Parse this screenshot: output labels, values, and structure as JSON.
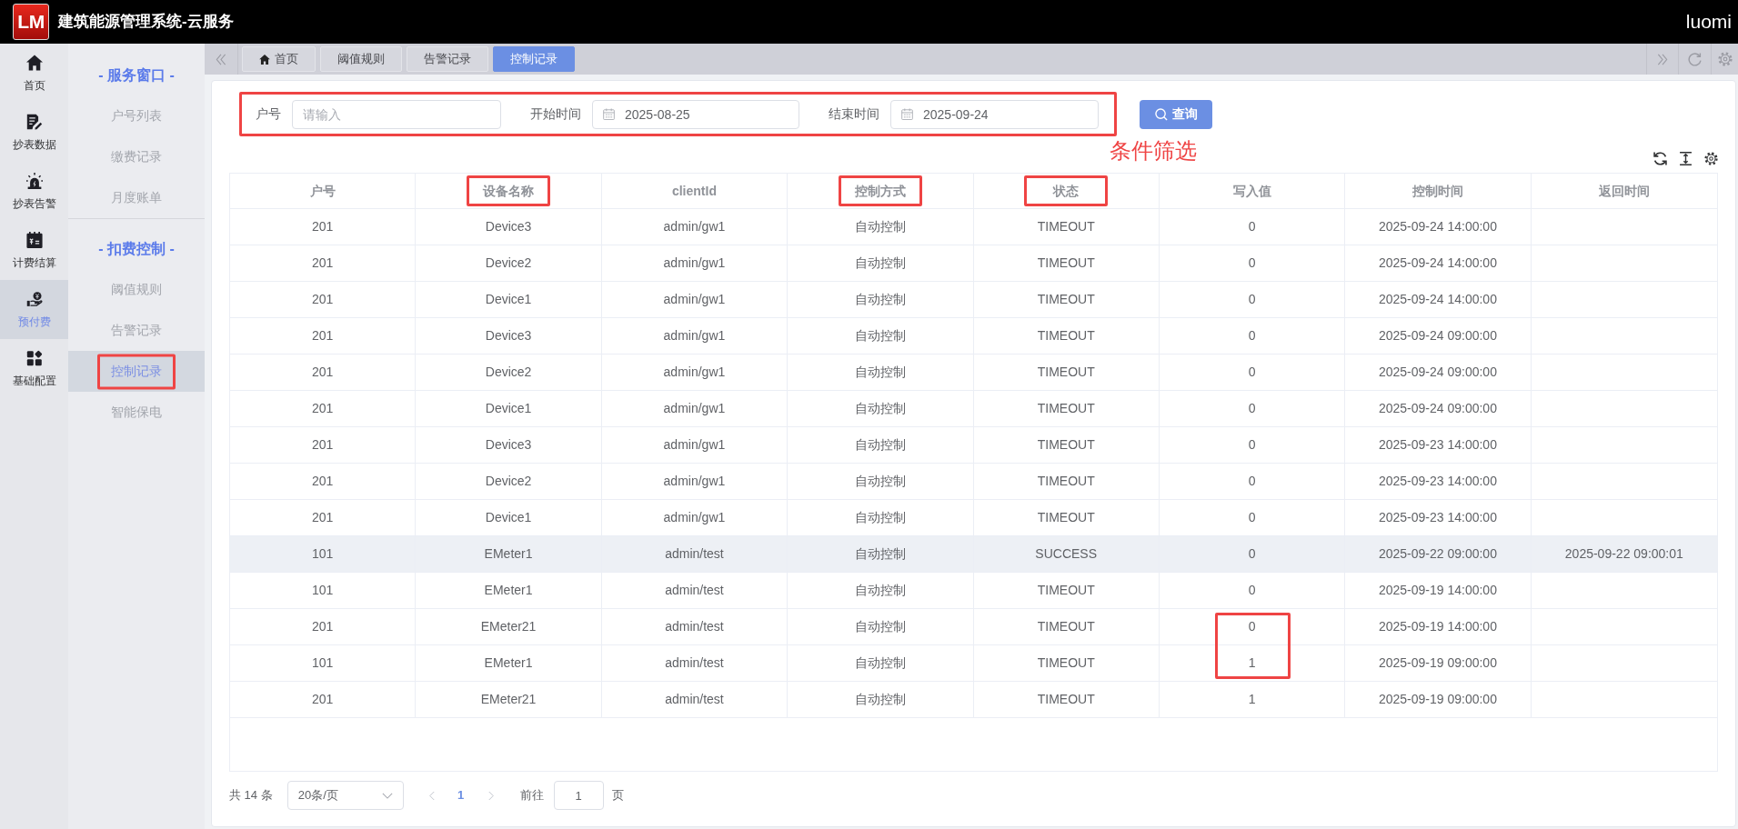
{
  "header": {
    "logo": "LM",
    "title": "建筑能源管理系统-云服务",
    "user": "luomi"
  },
  "nav_rail": [
    {
      "label": "首页",
      "selected": false
    },
    {
      "label": "抄表数据",
      "selected": false
    },
    {
      "label": "抄表告警",
      "selected": false
    },
    {
      "label": "计费结算",
      "selected": false
    },
    {
      "label": "预付费",
      "selected": true
    },
    {
      "label": "基础配置",
      "selected": false
    }
  ],
  "submenu": [
    {
      "title": "- 服务窗口 -",
      "items": [
        {
          "label": "户号列表",
          "selected": false,
          "highlighted": false
        },
        {
          "label": "缴费记录",
          "selected": false,
          "highlighted": false
        },
        {
          "label": "月度账单",
          "selected": false,
          "highlighted": false
        }
      ]
    },
    {
      "title": "- 扣费控制 -",
      "items": [
        {
          "label": "阈值规则",
          "selected": false,
          "highlighted": false
        },
        {
          "label": "告警记录",
          "selected": false,
          "highlighted": false
        },
        {
          "label": "控制记录",
          "selected": true,
          "highlighted": true
        },
        {
          "label": "智能保电",
          "selected": false,
          "highlighted": false
        }
      ]
    }
  ],
  "tabs": [
    {
      "kind": "home",
      "label": "首页",
      "selected": false
    },
    {
      "kind": "page",
      "label": "阈值规则",
      "selected": false
    },
    {
      "kind": "page",
      "label": "告警记录",
      "selected": false
    },
    {
      "kind": "page",
      "label": "控制记录",
      "selected": true
    }
  ],
  "filter": {
    "highlighted": true,
    "annotation": "条件筛选",
    "fields": [
      {
        "kind": "text",
        "label": "户号",
        "placeholder": "请输入"
      },
      {
        "kind": "date",
        "label": "开始时间",
        "value": "2025-08-25"
      },
      {
        "kind": "date",
        "label": "结束时间",
        "value": "2025-09-24"
      }
    ],
    "search_button": "查询"
  },
  "table": {
    "columns": [
      {
        "label": "户号",
        "highlighted": false
      },
      {
        "label": "设备名称",
        "highlighted": true
      },
      {
        "label": "clientId",
        "highlighted": false
      },
      {
        "label": "控制方式",
        "highlighted": true
      },
      {
        "label": "状态",
        "highlighted": true
      },
      {
        "label": "写入值",
        "highlighted": false
      },
      {
        "label": "控制时间",
        "highlighted": false
      },
      {
        "label": "返回时间",
        "highlighted": false
      }
    ],
    "rows": [
      {
        "account": "201",
        "device": "Device3",
        "client_id": "admin/gw1",
        "mode": "自动控制",
        "status": "TIMEOUT",
        "write_value": "0",
        "control_time": "2025-09-24 14:00:00",
        "hovered": false,
        "write_value_highlighted": false
      },
      {
        "account": "201",
        "device": "Device2",
        "client_id": "admin/gw1",
        "mode": "自动控制",
        "status": "TIMEOUT",
        "write_value": "0",
        "control_time": "2025-09-24 14:00:00",
        "hovered": false,
        "write_value_highlighted": false
      },
      {
        "account": "201",
        "device": "Device1",
        "client_id": "admin/gw1",
        "mode": "自动控制",
        "status": "TIMEOUT",
        "write_value": "0",
        "control_time": "2025-09-24 14:00:00",
        "hovered": false,
        "write_value_highlighted": false
      },
      {
        "account": "201",
        "device": "Device3",
        "client_id": "admin/gw1",
        "mode": "自动控制",
        "status": "TIMEOUT",
        "write_value": "0",
        "control_time": "2025-09-24 09:00:00",
        "hovered": false,
        "write_value_highlighted": false
      },
      {
        "account": "201",
        "device": "Device2",
        "client_id": "admin/gw1",
        "mode": "自动控制",
        "status": "TIMEOUT",
        "write_value": "0",
        "control_time": "2025-09-24 09:00:00",
        "hovered": false,
        "write_value_highlighted": false
      },
      {
        "account": "201",
        "device": "Device1",
        "client_id": "admin/gw1",
        "mode": "自动控制",
        "status": "TIMEOUT",
        "write_value": "0",
        "control_time": "2025-09-24 09:00:00",
        "hovered": false,
        "write_value_highlighted": false
      },
      {
        "account": "201",
        "device": "Device3",
        "client_id": "admin/gw1",
        "mode": "自动控制",
        "status": "TIMEOUT",
        "write_value": "0",
        "control_time": "2025-09-23 14:00:00",
        "hovered": false,
        "write_value_highlighted": false
      },
      {
        "account": "201",
        "device": "Device2",
        "client_id": "admin/gw1",
        "mode": "自动控制",
        "status": "TIMEOUT",
        "write_value": "0",
        "control_time": "2025-09-23 14:00:00",
        "hovered": false,
        "write_value_highlighted": false
      },
      {
        "account": "201",
        "device": "Device1",
        "client_id": "admin/gw1",
        "mode": "自动控制",
        "status": "TIMEOUT",
        "write_value": "0",
        "control_time": "2025-09-23 14:00:00",
        "hovered": false,
        "write_value_highlighted": false
      },
      {
        "account": "101",
        "device": "EMeter1",
        "client_id": "admin/test",
        "mode": "自动控制",
        "status": "SUCCESS",
        "write_value": "0",
        "control_time": "2025-09-22 09:00:00",
        "return_time": "2025-09-22 09:00:01",
        "hovered": true,
        "write_value_highlighted": false
      },
      {
        "account": "101",
        "device": "EMeter1",
        "client_id": "admin/test",
        "mode": "自动控制",
        "status": "TIMEOUT",
        "write_value": "0",
        "control_time": "2025-09-19 14:00:00",
        "hovered": false,
        "write_value_highlighted": false
      },
      {
        "account": "201",
        "device": "EMeter21",
        "client_id": "admin/test",
        "mode": "自动控制",
        "status": "TIMEOUT",
        "write_value": "0",
        "control_time": "2025-09-19 14:00:00",
        "hovered": false,
        "write_value_highlighted": true
      },
      {
        "account": "101",
        "device": "EMeter1",
        "client_id": "admin/test",
        "mode": "自动控制",
        "status": "TIMEOUT",
        "write_value": "1",
        "control_time": "2025-09-19 09:00:00",
        "hovered": false,
        "write_value_highlighted": true
      },
      {
        "account": "201",
        "device": "EMeter21",
        "client_id": "admin/test",
        "mode": "自动控制",
        "status": "TIMEOUT",
        "write_value": "1",
        "control_time": "2025-09-19 09:00:00",
        "hovered": false,
        "write_value_highlighted": false
      }
    ]
  },
  "pagination": {
    "total": "共 14 条",
    "page_size": "20条/页",
    "prev": {
      "disabled": true
    },
    "pages": [
      {
        "label": "1",
        "selected": true
      }
    ],
    "next": {
      "disabled": true
    },
    "goto_label": "前往",
    "goto_value": "1",
    "goto_suffix": "页"
  }
}
